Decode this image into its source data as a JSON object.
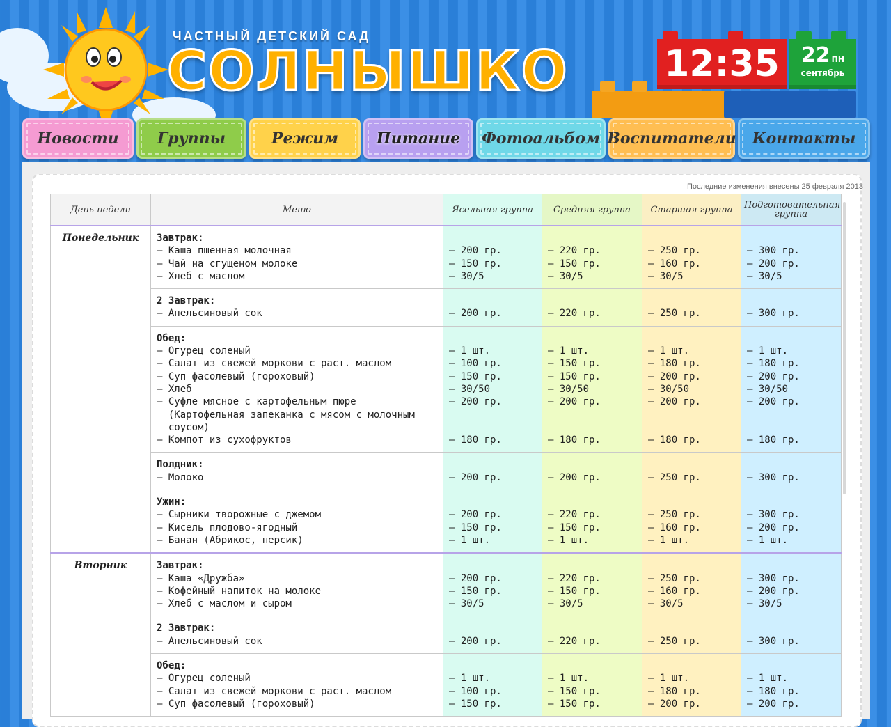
{
  "header": {
    "subtitle": "ЧАСТНЫЙ ДЕТСКИЙ САД",
    "brand": "СОЛНЫШКО",
    "time": "12:35",
    "day": "22",
    "weekday": "ПН",
    "month": "сентябрь"
  },
  "nav": {
    "items": [
      {
        "label": "Новости",
        "color": "#f59bd2"
      },
      {
        "label": "Группы",
        "color": "#8fcc4a"
      },
      {
        "label": "Режим",
        "color": "#ffd24a"
      },
      {
        "label": "Питание",
        "color": "#b8a0f0"
      },
      {
        "label": "Фотоальбом",
        "color": "#6fd8e8"
      },
      {
        "label": "Воспитатели",
        "color": "#ffbe52"
      },
      {
        "label": "Контакты",
        "color": "#4aa7ea"
      }
    ]
  },
  "table": {
    "updated": "Последние изменения внесены 25 февраля 2013",
    "headers": [
      "День недели",
      "Меню",
      "Ясельная группа",
      "Средняя группа",
      "Старшая группа",
      "Подготовительная группа"
    ],
    "rows": [
      {
        "day": "Понедельник",
        "rowspan": 5,
        "meal": "Завтрак:",
        "items": "– Каша пшенная молочная\n– Чай на сгущеном молоке\n– Хлеб с маслом",
        "g1": "\n– 200 гр.\n– 150 гр.\n– 30/5",
        "g2": "\n– 220 гр.\n– 150 гр.\n– 30/5",
        "g3": "\n– 250 гр.\n– 160 гр.\n– 30/5",
        "g4": "\n– 300 гр.\n– 200 гр.\n– 30/5"
      },
      {
        "meal": "2 Завтрак:",
        "items": "– Апельсиновый сок",
        "g1": "\n– 200 гр.",
        "g2": "\n– 220 гр.",
        "g3": "\n– 250 гр.",
        "g4": "\n– 300 гр."
      },
      {
        "meal": "Обед:",
        "items": "– Огурец соленый\n– Салат из свежей моркови с раст. маслом\n– Суп фасолевый (гороховый)\n– Хлеб\n– Суфле мясное с картофельным пюре\n  (Картофельная запеканка с мясом с молочным\n  соусом)\n– Компот из сухофруктов",
        "g1": "\n– 1 шт.\n– 100 гр.\n– 150 гр.\n– 30/50\n– 200 гр.\n\n\n– 180 гр.",
        "g2": "\n– 1 шт.\n– 150 гр.\n– 150 гр.\n– 30/50\n– 200 гр.\n\n\n– 180 гр.",
        "g3": "\n– 1 шт.\n– 180 гр.\n– 200 гр.\n– 30/50\n– 200 гр.\n\n\n– 180 гр.",
        "g4": "\n– 1 шт.\n– 180 гр.\n– 200 гр.\n– 30/50\n– 200 гр.\n\n\n– 180 гр."
      },
      {
        "meal": "Полдник:",
        "items": "– Молоко",
        "g1": "\n– 200 гр.",
        "g2": "\n– 200 гр.",
        "g3": "\n– 250 гр.",
        "g4": "\n– 300 гр."
      },
      {
        "meal": "Ужин:",
        "items": "– Сырники творожные с джемом\n– Кисель плодово-ягодный\n– Банан (Абрикос, персик)",
        "g1": "\n– 200 гр.\n– 150 гр.\n– 1 шт.",
        "g2": "\n– 220 гр.\n– 150 гр.\n– 1 шт.",
        "g3": "\n– 250 гр.\n– 160 гр.\n– 1 шт.",
        "g4": "\n– 300 гр.\n– 200 гр.\n– 1 шт."
      },
      {
        "day": "Вторник",
        "rowspan": 3,
        "meal": "Завтрак:",
        "items": "– Каша «Дружба»\n– Кофейный напиток на молоке\n– Хлеб с маслом и сыром",
        "g1": "\n– 200 гр.\n– 150 гр.\n– 30/5",
        "g2": "\n– 220 гр.\n– 150 гр.\n– 30/5",
        "g3": "\n– 250 гр.\n– 160 гр.\n– 30/5",
        "g4": "\n– 300 гр.\n– 200 гр.\n– 30/5"
      },
      {
        "meal": "2 Завтрак:",
        "items": "– Апельсиновый сок",
        "g1": "\n– 200 гр.",
        "g2": "\n– 220 гр.",
        "g3": "\n– 250 гр.",
        "g4": "\n– 300 гр."
      },
      {
        "meal": "Обед:",
        "items": "– Огурец соленый\n– Салат из свежей моркови с раст. маслом\n– Суп фасолевый (гороховый)",
        "g1": "\n– 1 шт.\n– 100 гр.\n– 150 гр.",
        "g2": "\n– 1 шт.\n– 150 гр.\n– 150 гр.",
        "g3": "\n– 1 шт.\n– 180 гр.\n– 200 гр.",
        "g4": "\n– 1 шт.\n– 180 гр.\n– 200 гр."
      }
    ]
  }
}
